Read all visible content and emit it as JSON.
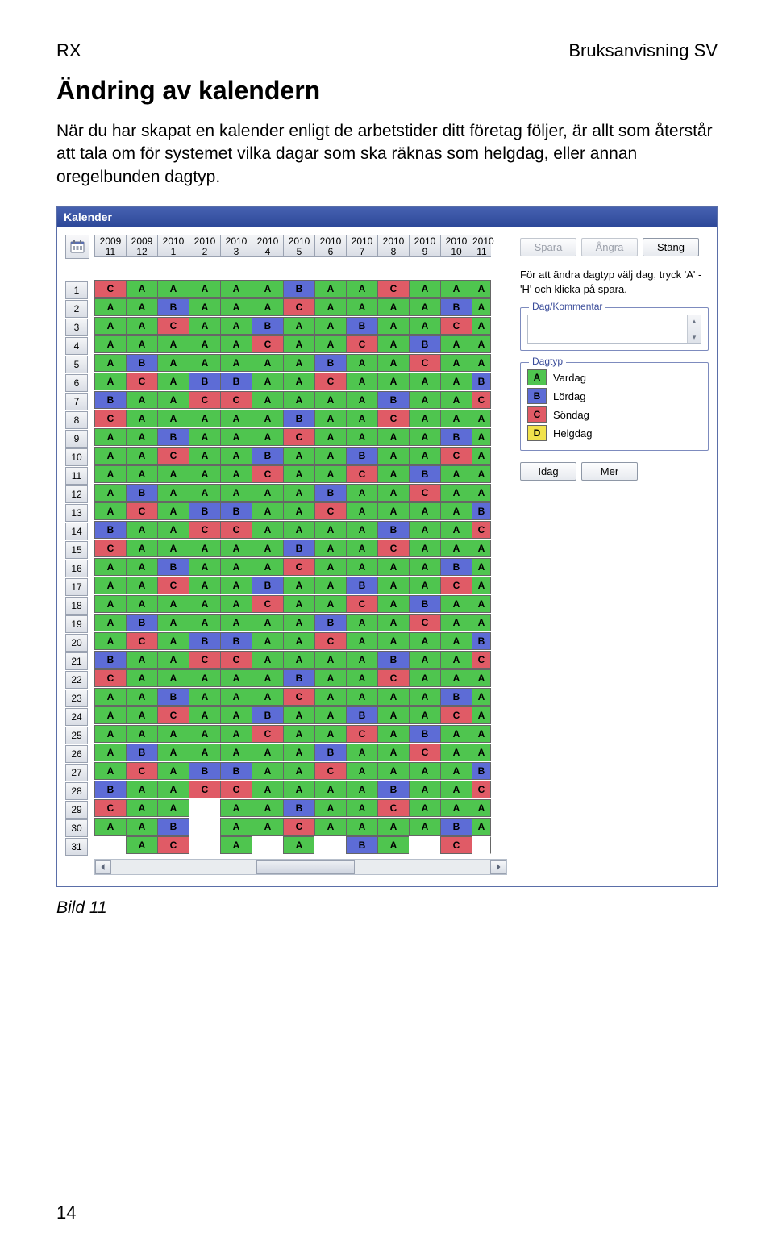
{
  "header": {
    "left": "RX",
    "right": "Bruksanvisning SV"
  },
  "title": "Ändring av kalendern",
  "intro": "När du har skapat en kalender enligt de arbetstider ditt företag följer, är allt som återstår att tala om för systemet vilka dagar som ska räknas som helgdag, eller annan oregelbunden dagtyp.",
  "window_title": "Kalender",
  "month_headers": [
    {
      "y": "2009",
      "m": "11"
    },
    {
      "y": "2009",
      "m": "12"
    },
    {
      "y": "2010",
      "m": "1"
    },
    {
      "y": "2010",
      "m": "2"
    },
    {
      "y": "2010",
      "m": "3"
    },
    {
      "y": "2010",
      "m": "4"
    },
    {
      "y": "2010",
      "m": "5"
    },
    {
      "y": "2010",
      "m": "6"
    },
    {
      "y": "2010",
      "m": "7"
    },
    {
      "y": "2010",
      "m": "8"
    },
    {
      "y": "2010",
      "m": "9"
    },
    {
      "y": "2010",
      "m": "10"
    },
    {
      "y": "2010",
      "m": "11"
    }
  ],
  "grid": [
    [
      "C",
      "A",
      "A",
      "A",
      "A",
      "A",
      "B",
      "A",
      "A",
      "C",
      "A",
      "A",
      "A"
    ],
    [
      "A",
      "A",
      "B",
      "A",
      "A",
      "A",
      "C",
      "A",
      "A",
      "A",
      "A",
      "B",
      "A"
    ],
    [
      "A",
      "A",
      "C",
      "A",
      "A",
      "B",
      "A",
      "A",
      "B",
      "A",
      "A",
      "C",
      "A"
    ],
    [
      "A",
      "A",
      "A",
      "A",
      "A",
      "C",
      "A",
      "A",
      "C",
      "A",
      "B",
      "A",
      "A"
    ],
    [
      "A",
      "B",
      "A",
      "A",
      "A",
      "A",
      "A",
      "B",
      "A",
      "A",
      "C",
      "A",
      "A"
    ],
    [
      "A",
      "C",
      "A",
      "B",
      "B",
      "A",
      "A",
      "C",
      "A",
      "A",
      "A",
      "A",
      "B"
    ],
    [
      "B",
      "A",
      "A",
      "C",
      "C",
      "A",
      "A",
      "A",
      "A",
      "B",
      "A",
      "A",
      "C"
    ],
    [
      "C",
      "A",
      "A",
      "A",
      "A",
      "A",
      "B",
      "A",
      "A",
      "C",
      "A",
      "A",
      "A"
    ],
    [
      "A",
      "A",
      "B",
      "A",
      "A",
      "A",
      "C",
      "A",
      "A",
      "A",
      "A",
      "B",
      "A"
    ],
    [
      "A",
      "A",
      "C",
      "A",
      "A",
      "B",
      "A",
      "A",
      "B",
      "A",
      "A",
      "C",
      "A"
    ],
    [
      "A",
      "A",
      "A",
      "A",
      "A",
      "C",
      "A",
      "A",
      "C",
      "A",
      "B",
      "A",
      "A"
    ],
    [
      "A",
      "B",
      "A",
      "A",
      "A",
      "A",
      "A",
      "B",
      "A",
      "A",
      "C",
      "A",
      "A"
    ],
    [
      "A",
      "C",
      "A",
      "B",
      "B",
      "A",
      "A",
      "C",
      "A",
      "A",
      "A",
      "A",
      "B"
    ],
    [
      "B",
      "A",
      "A",
      "C",
      "C",
      "A",
      "A",
      "A",
      "A",
      "B",
      "A",
      "A",
      "C"
    ],
    [
      "C",
      "A",
      "A",
      "A",
      "A",
      "A",
      "B",
      "A",
      "A",
      "C",
      "A",
      "A",
      "A"
    ],
    [
      "A",
      "A",
      "B",
      "A",
      "A",
      "A",
      "C",
      "A",
      "A",
      "A",
      "A",
      "B",
      "A"
    ],
    [
      "A",
      "A",
      "C",
      "A",
      "A",
      "B",
      "A",
      "A",
      "B",
      "A",
      "A",
      "C",
      "A"
    ],
    [
      "A",
      "A",
      "A",
      "A",
      "A",
      "C",
      "A",
      "A",
      "C",
      "A",
      "B",
      "A",
      "A"
    ],
    [
      "A",
      "B",
      "A",
      "A",
      "A",
      "A",
      "A",
      "B",
      "A",
      "A",
      "C",
      "A",
      "A"
    ],
    [
      "A",
      "C",
      "A",
      "B",
      "B",
      "A",
      "A",
      "C",
      "A",
      "A",
      "A",
      "A",
      "B"
    ],
    [
      "B",
      "A",
      "A",
      "C",
      "C",
      "A",
      "A",
      "A",
      "A",
      "B",
      "A",
      "A",
      "C"
    ],
    [
      "C",
      "A",
      "A",
      "A",
      "A",
      "A",
      "B",
      "A",
      "A",
      "C",
      "A",
      "A",
      "A"
    ],
    [
      "A",
      "A",
      "B",
      "A",
      "A",
      "A",
      "C",
      "A",
      "A",
      "A",
      "A",
      "B",
      "A"
    ],
    [
      "A",
      "A",
      "C",
      "A",
      "A",
      "B",
      "A",
      "A",
      "B",
      "A",
      "A",
      "C",
      "A"
    ],
    [
      "A",
      "A",
      "A",
      "A",
      "A",
      "C",
      "A",
      "A",
      "C",
      "A",
      "B",
      "A",
      "A"
    ],
    [
      "A",
      "B",
      "A",
      "A",
      "A",
      "A",
      "A",
      "B",
      "A",
      "A",
      "C",
      "A",
      "A"
    ],
    [
      "A",
      "C",
      "A",
      "B",
      "B",
      "A",
      "A",
      "C",
      "A",
      "A",
      "A",
      "A",
      "B"
    ],
    [
      "B",
      "A",
      "A",
      "C",
      "C",
      "A",
      "A",
      "A",
      "A",
      "B",
      "A",
      "A",
      "C"
    ],
    [
      "C",
      "A",
      "A",
      "",
      "A",
      "A",
      "B",
      "A",
      "A",
      "C",
      "A",
      "A",
      "A"
    ],
    [
      "A",
      "A",
      "B",
      "",
      "A",
      "A",
      "C",
      "A",
      "A",
      "A",
      "A",
      "B",
      "A"
    ],
    [
      "",
      "A",
      "C",
      "",
      "A",
      "",
      "A",
      "",
      "B",
      "A",
      "",
      "C",
      ""
    ]
  ],
  "buttons": {
    "save": "Spara",
    "undo": "Ångra",
    "close": "Stäng",
    "today": "Idag",
    "more": "Mer"
  },
  "help_text": "För att ändra dagtyp välj dag, tryck 'A' - 'H' och klicka på spara.",
  "fieldsets": {
    "comment": "Dag/Kommentar",
    "daytype": "Dagtyp"
  },
  "daytype_legend": [
    {
      "code": "A",
      "label": "Vardag",
      "cls": "dt-A"
    },
    {
      "code": "B",
      "label": "Lördag",
      "cls": "dt-B"
    },
    {
      "code": "C",
      "label": "Söndag",
      "cls": "dt-C"
    },
    {
      "code": "D",
      "label": "Helgdag",
      "cls": "dt-D"
    }
  ],
  "caption": "Bild 11",
  "page_number": "14"
}
